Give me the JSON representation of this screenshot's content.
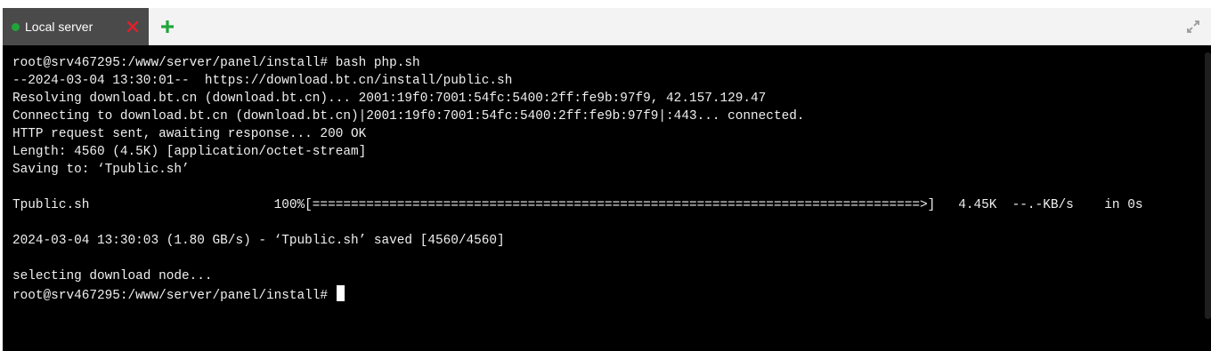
{
  "tabbar": {
    "tab": {
      "label": "Local server",
      "status": "connected",
      "status_color": "#20a53a",
      "close_icon": "close-icon",
      "close_color": "#e0202c"
    },
    "add_tab_icon": "plus-icon",
    "add_tab_color": "#20a53a",
    "expand_icon": "expand-icon"
  },
  "terminal": {
    "background": "#000000",
    "foreground": "#f0f0f0",
    "lines": [
      "root@srv467295:/www/server/panel/install# bash php.sh",
      "--2024-03-04 13:30:01--  https://download.bt.cn/install/public.sh",
      "Resolving download.bt.cn (download.bt.cn)... 2001:19f0:7001:54fc:5400:2ff:fe9b:97f9, 42.157.129.47",
      "Connecting to download.bt.cn (download.bt.cn)|2001:19f0:7001:54fc:5400:2ff:fe9b:97f9|:443... connected.",
      "HTTP request sent, awaiting response... 200 OK",
      "Length: 4560 (4.5K) [application/octet-stream]",
      "Saving to: ‘Tpublic.sh’",
      "",
      "Tpublic.sh                        100%[===============================================================================>]   4.45K  --.-KB/s    in 0s",
      "",
      "2024-03-04 13:30:03 (1.80 GB/s) - ‘Tpublic.sh’ saved [4560/4560]",
      "",
      "selecting download node...",
      "root@srv467295:/www/server/panel/install# "
    ],
    "cursor_line": 13
  }
}
